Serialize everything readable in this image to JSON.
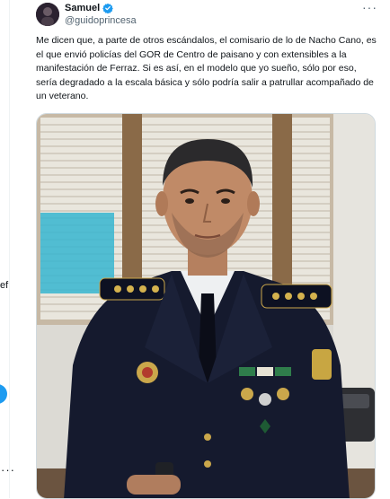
{
  "tweet": {
    "author_name": "Samuel",
    "author_handle": "@guidoprincesa",
    "more_label": "···",
    "text": "Me dicen que, a parte de otros escándalos, el comisario de lo de Nacho Cano, es el que envió policías del GOR de Centro de paisano y con extensibles a la manifestación de Ferraz. Si es así, en el modelo que yo sueño, sólo por eso, sería degradado a la escala básica y sólo podría salir a patrullar acompañado de un veterano.",
    "image_description": "photo-of-uniformed-police-officer"
  },
  "sidebar_fragment": {
    "text": "ef",
    "more_label": "···"
  },
  "colors": {
    "verified_blue": "#1d9bf0",
    "uniform_navy": "#151a2e"
  }
}
